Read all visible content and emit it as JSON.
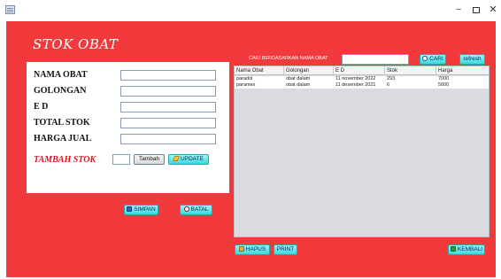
{
  "window": {
    "minimize_glyph": "–",
    "close_glyph": "✕"
  },
  "title": "STOK OBAT",
  "form": {
    "labels": {
      "nama_obat": "NAMA OBAT",
      "golongan": "GOLONGAN",
      "ed": "E D",
      "total_stok": "TOTAL STOK",
      "harga_jual": "HARGA JUAL",
      "tambah_stok": "TAMBAH STOK"
    },
    "values": {
      "nama_obat": "",
      "golongan": "",
      "ed": "",
      "total_stok": "",
      "harga_jual": "",
      "tambah_qty": ""
    },
    "buttons": {
      "tambah": "Tambah",
      "update": "UPDATE",
      "simpan": "SIMPAN",
      "batal": "BATAL"
    }
  },
  "search": {
    "label": "CARI BERDASARKAN NAMA OBAT",
    "value": "",
    "cari_label": "CARI",
    "refresh_label": "refresh"
  },
  "table": {
    "columns": [
      "Nama Obat",
      "Golongan",
      "E D",
      "Stok",
      "Harga"
    ],
    "rows": [
      [
        "paradol",
        "obat dalam",
        "11 november 2022",
        "293",
        "7000"
      ],
      [
        "paramex",
        "obat dalam",
        "11 desember 2021",
        "6",
        "5000"
      ]
    ]
  },
  "bottom": {
    "hapus": "HAPUS",
    "print": "PRINT",
    "kembali": "KEMBALI"
  },
  "colors": {
    "background": "#f23a3c",
    "accent_button": "#38d9dc",
    "stock_label": "#e8101c"
  }
}
